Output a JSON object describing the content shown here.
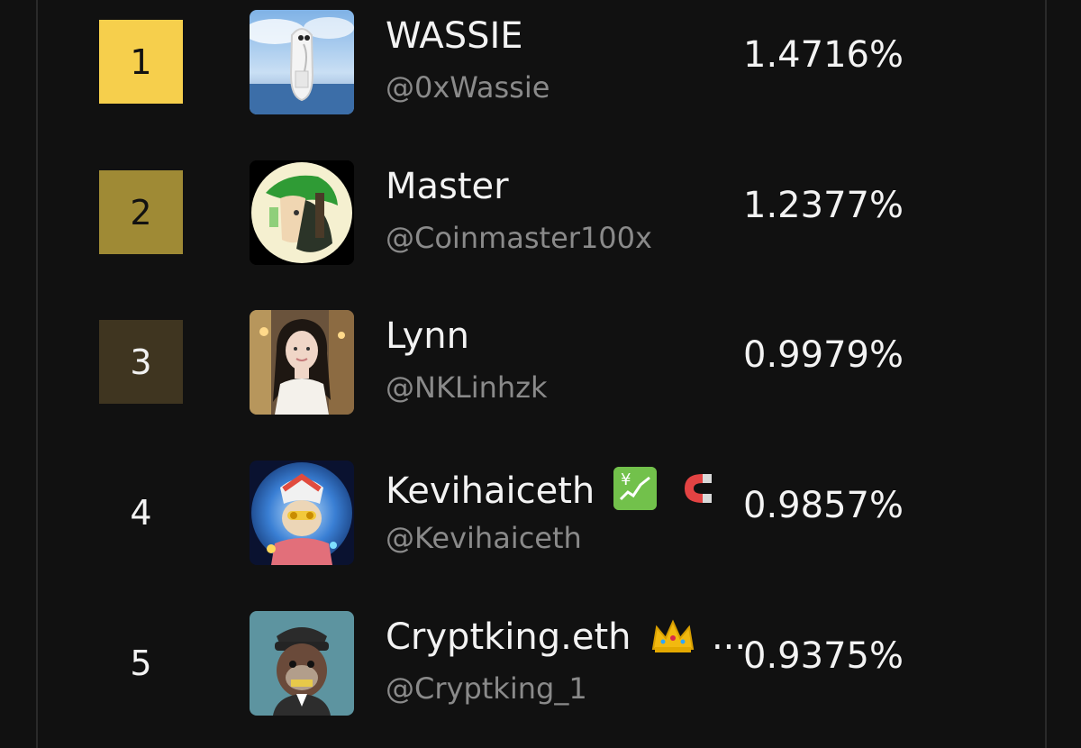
{
  "leaderboard": {
    "rows": [
      {
        "rank": "1",
        "name": "WASSIE",
        "handle": "@0xWassie",
        "percent": "1.4716%",
        "rank_color": "#f6cf4c",
        "avatar": "wassie-avatar"
      },
      {
        "rank": "2",
        "name": "Master",
        "handle": "@Coinmaster100x",
        "percent": "1.2377%",
        "rank_color": "#9f8a35",
        "avatar": "master-avatar"
      },
      {
        "rank": "3",
        "name": "Lynn",
        "handle": "@NKLinhzk",
        "percent": "0.9979%",
        "rank_color": "#3f3520",
        "avatar": "lynn-avatar"
      },
      {
        "rank": "4",
        "name": "Kevihaiceth",
        "handle": "@Kevihaiceth",
        "percent": "0.9857%",
        "avatar": "kevihaiceth-avatar",
        "name_suffix_icons": [
          "chart-up-yen-icon",
          "magnet-icon"
        ]
      },
      {
        "rank": "5",
        "name": "Cryptking.eth",
        "handle": "@Cryptking_1",
        "percent": "0.9375%",
        "avatar": "cryptking-avatar",
        "name_suffix_icons": [
          "crown-icon"
        ],
        "name_overflow": "..."
      }
    ]
  },
  "colors": {
    "background": "#111111",
    "text_primary": "#f3f3f3",
    "text_secondary": "#8a8a8a",
    "gold": "#f6cf4c",
    "silver": "#9f8a35",
    "bronze": "#3f3520"
  }
}
